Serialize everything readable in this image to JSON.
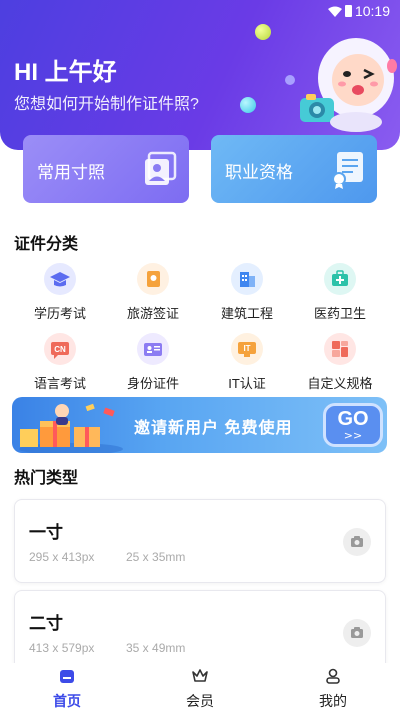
{
  "status_bar": {
    "time": "10:19"
  },
  "header": {
    "greeting": "HI 上午好",
    "subtitle": "您想如何开始制作证件照?"
  },
  "quick_cards": [
    {
      "label": "常用寸照"
    },
    {
      "label": "职业资格"
    }
  ],
  "categories_section": {
    "title": "证件分类",
    "items": [
      {
        "label": "学历考试",
        "icon": "graduation-cap-icon"
      },
      {
        "label": "旅游签证",
        "icon": "travel-visa-icon"
      },
      {
        "label": "建筑工程",
        "icon": "building-icon"
      },
      {
        "label": "医药卫生",
        "icon": "medical-kit-icon"
      },
      {
        "label": "语言考试",
        "icon": "language-cn-icon",
        "glyph": "CN"
      },
      {
        "label": "身份证件",
        "icon": "id-card-icon"
      },
      {
        "label": "IT认证",
        "icon": "it-cert-icon",
        "glyph": "IT"
      },
      {
        "label": "自定义规格",
        "icon": "custom-grid-icon"
      }
    ]
  },
  "banner": {
    "text": "邀请新用户 免费使用",
    "go_label": "GO",
    "go_arrow": ">>"
  },
  "popular_section": {
    "title": "热门类型",
    "items": [
      {
        "name": "一寸",
        "px": "295 x 413px",
        "mm": "25 x 35mm"
      },
      {
        "name": "二寸",
        "px": "413 x 579px",
        "mm": "35 x 49mm"
      }
    ]
  },
  "tabbar": {
    "items": [
      {
        "label": "首页",
        "active": true
      },
      {
        "label": "会员",
        "active": false
      },
      {
        "label": "我的",
        "active": false
      }
    ]
  },
  "colors": {
    "header_start": "#4d3fe0",
    "header_end": "#8a5cf0",
    "accent": "#3d4be8"
  }
}
